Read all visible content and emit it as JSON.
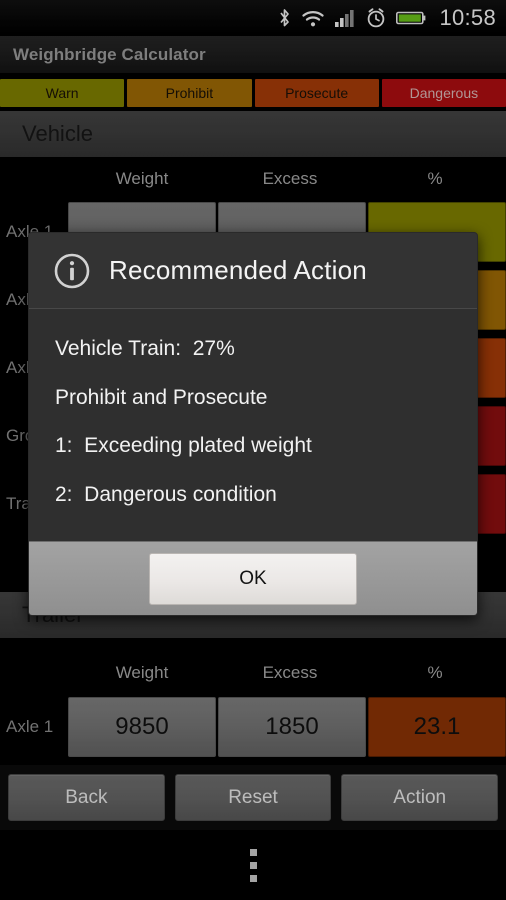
{
  "statusbar": {
    "time": "10:58",
    "icons": [
      "bluetooth-icon",
      "wifi-icon",
      "signal-icon",
      "alarm-icon",
      "battery-icon"
    ],
    "battery_color": "#6bc11a"
  },
  "titlebar": {
    "app_title": "Weighbridge Calculator"
  },
  "legend": {
    "items": [
      {
        "label": "Warn",
        "color": "#7f7f00",
        "text_color": "#1a1208"
      },
      {
        "label": "Prohibit",
        "color": "#9e6a06",
        "text_color": "#1a1208"
      },
      {
        "label": "Prosecute",
        "color": "#a53b08",
        "text_color": "#1a1208"
      },
      {
        "label": "Dangerous",
        "color": "#ac0e11",
        "text_color": "#d8b8b6"
      }
    ]
  },
  "vehicle_section": {
    "header": "Vehicle",
    "columns": [
      "Weight",
      "Excess",
      "%"
    ],
    "rows": [
      {
        "label": "Axle 1",
        "weight": "",
        "excess": "",
        "pct": "",
        "pct_color": "#7f7f00"
      },
      {
        "label": "Axle 2",
        "weight": "",
        "excess": "",
        "pct": "",
        "pct_color": "#9e6a06"
      },
      {
        "label": "Axle 3",
        "weight": "",
        "excess": "",
        "pct": "",
        "pct_color": "#a53b08"
      },
      {
        "label": "Group",
        "weight": "",
        "excess": "",
        "pct": "",
        "pct_color": "#8c0f10"
      },
      {
        "label": "Train",
        "weight": "",
        "excess": "",
        "pct": "",
        "pct_color": "#8c0f10"
      }
    ]
  },
  "trailer_section": {
    "header": "Trailer",
    "columns": [
      "Weight",
      "Excess",
      "%"
    ],
    "rows": [
      {
        "label": "Axle 1",
        "weight": "9850",
        "excess": "1850",
        "pct": "23.1",
        "pct_color": "#8a3206"
      }
    ]
  },
  "dialog": {
    "title": "Recommended Action",
    "icon": "info-icon",
    "lines": [
      "Vehicle Train:  27%",
      "Prohibit and Prosecute",
      "1:  Exceeding plated weight",
      "2:  Dangerous condition"
    ],
    "ok_label": "OK"
  },
  "buttonbar": {
    "buttons": [
      "Back",
      "Reset",
      "Action"
    ]
  },
  "navbar": {
    "overflow": "overflow-menu"
  }
}
